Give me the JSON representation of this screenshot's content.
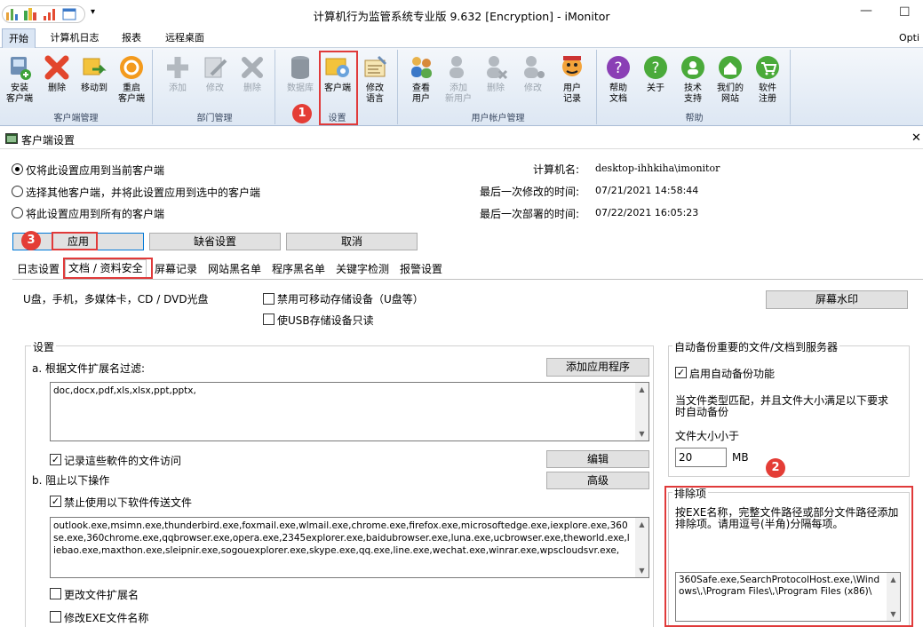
{
  "window": {
    "title": "计算机行为监管系统专业版 9.632 [Encryption] - iMonitor",
    "qa_menu_icon": "▾",
    "minimize": "—",
    "maximize": "☐",
    "quick_access_icons": [
      "bar-chart-icon",
      "bar-chart-icon",
      "signal-icon",
      "window-icon"
    ]
  },
  "ribbon_tabs": [
    {
      "label": "开始",
      "active": true
    },
    {
      "label": "计算机日志"
    },
    {
      "label": "报表"
    },
    {
      "label": "远程桌面"
    }
  ],
  "ribbon_options_label": "Opti",
  "ribbon_groups": [
    {
      "label": "客户端管理",
      "buttons": [
        {
          "label": "安装\n客户端",
          "icon": "install-client-icon"
        },
        {
          "label": "删除",
          "icon": "delete-icon"
        },
        {
          "label": "移动到",
          "icon": "move-icon"
        },
        {
          "label": "重启\n客户端",
          "icon": "restart-icon"
        }
      ]
    },
    {
      "label": "部门管理",
      "buttons": [
        {
          "label": "添加",
          "icon": "add-icon",
          "disabled": true
        },
        {
          "label": "修改",
          "icon": "edit-icon",
          "disabled": true
        },
        {
          "label": "删除",
          "icon": "delete-icon",
          "disabled": true
        }
      ]
    },
    {
      "label": "设置",
      "buttons": [
        {
          "label": "数据库",
          "icon": "database-icon"
        },
        {
          "label": "客户端",
          "icon": "client-settings-icon"
        },
        {
          "label": "修改\n语言",
          "icon": "language-icon"
        }
      ]
    },
    {
      "label": "用户帐户管理",
      "buttons": [
        {
          "label": "查看\n用户",
          "icon": "view-users-icon"
        },
        {
          "label": "添加\n新用户",
          "icon": "add-user-icon",
          "disabled": true
        },
        {
          "label": "删除",
          "icon": "delete-user-icon",
          "disabled": true
        },
        {
          "label": "修改",
          "icon": "edit-user-icon",
          "disabled": true
        },
        {
          "label": "用户\n记录",
          "icon": "user-log-icon"
        }
      ]
    },
    {
      "label": "帮助",
      "buttons": [
        {
          "label": "帮助\n文档",
          "icon": "help-icon"
        },
        {
          "label": "关于",
          "icon": "about-icon"
        },
        {
          "label": "技术\n支持",
          "icon": "support-icon"
        },
        {
          "label": "我们的\n网站",
          "icon": "website-icon"
        },
        {
          "label": "软件\n注册",
          "icon": "register-icon"
        }
      ]
    }
  ],
  "annotations": {
    "badge1": "1",
    "badge2": "2",
    "badge3": "3"
  },
  "dialog": {
    "title": "客户端设置",
    "close": "✕",
    "radio_current": "仅将此设置应用到当前客户端",
    "radio_selected": "选择其他客户端，并将此设置应用到选中的客户端",
    "radio_all": "将此设置应用到所有的客户端",
    "computer_name_label": "计算机名:",
    "computer_name": "desktop-ihhkiha\\imonitor",
    "last_modified_label": "最后一次修改的时间:",
    "last_modified": "07/21/2021 14:58:44",
    "last_deployed_label": "最后一次部署的时间:",
    "last_deployed": "07/22/2021 16:05:23",
    "apply": "应用",
    "default": "缺省设置",
    "cancel": "取消",
    "tabs": [
      "日志设置",
      "文档 / 资料安全",
      "屏幕记录",
      "网站黑名单",
      "程序黑名单",
      "关键字检测",
      "报警设置"
    ],
    "media_label": "U盘，手机，多媒体卡，CD / DVD光盘",
    "disable_removable": "禁用可移动存储设备（U盘等）",
    "usb_readonly": "使USB存储设备只读",
    "watermark": "屏幕水印",
    "settings_legend": "设置",
    "filter_label": "a. 根据文件扩展名过滤:",
    "add_app": "添加应用程序",
    "extensions": "doc,docx,pdf,xls,xlsx,ppt,pptx,",
    "record_access": "记录這些軟件的文件访问",
    "edit": "编辑",
    "block_label": "b. 阻止以下操作",
    "advanced": "高级",
    "forbid_send": "禁止使用以下软件传送文件",
    "programs": "outlook.exe,msimn.exe,thunderbird.exe,foxmail.exe,wlmail.exe,chrome.exe,firefox.exe,microsoftedge.exe,iexplore.exe,360se.exe,360chrome.exe,qqbrowser.exe,opera.exe,2345explorer.exe,baidubrowser.exe,luna.exe,ucbrowser.exe,theworld.exe,liebao.exe,maxthon.exe,sleipnir.exe,sogouexplorer.exe,skype.exe,qq.exe,line.exe,wechat.exe,winrar.exe,wpscloudsvr.exe,",
    "change_ext": "更改文件扩展名",
    "change_exe": "修改EXE文件名称",
    "backup_legend": "自动备份重要的文件/文档到服务器",
    "enable_backup": "启用自动备份功能",
    "backup_desc": "当文件类型匹配，并且文件大小满足以下要求时自动备份",
    "size_label": "文件大小小于",
    "size_value": "20",
    "size_unit": "MB",
    "exclude_legend": "排除项",
    "exclude_desc": "按EXE名称，完整文件路径或部分文件路径添加排除项。请用逗号(半角)分隔每项。",
    "exclude_value": "360Safe.exe,SearchProtocolHost.exe,\\Windows\\,\\Program Files\\,\\Program Files (x86)\\"
  },
  "colors": {
    "accent_red": "#e03a3a",
    "ribbon_bg": "#dde7f3"
  }
}
